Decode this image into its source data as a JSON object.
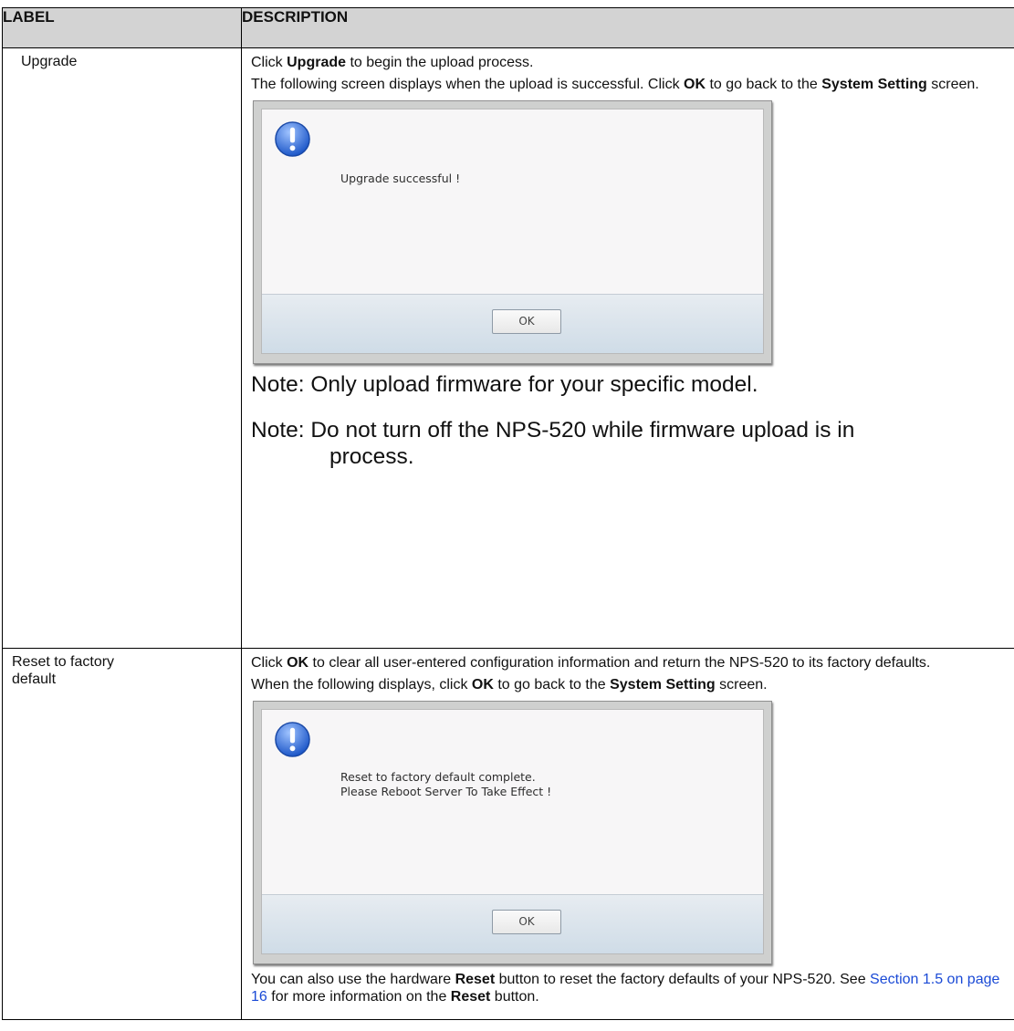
{
  "table": {
    "header_label": "LABEL",
    "header_description": "DESCRIPTION"
  },
  "rows": [
    {
      "label": "Upgrade",
      "p1": {
        "pre": "Click ",
        "b1": "Upgrade",
        "post": " to begin the upload process."
      },
      "p2": {
        "pre": "The following screen displays when the upload is successful. Click ",
        "b1": "OK",
        "mid": " to go back to the ",
        "b2": "System Setting",
        "post": " screen."
      },
      "dialog": {
        "message_line1": "Upgrade successful !",
        "ok_label": "OK"
      },
      "note1": "Note: Only upload firmware for your specific model.",
      "note2_line1": "Note: Do not turn off the NPS-520 while firmware upload is in",
      "note2_line2": "process."
    },
    {
      "label": "Reset to factory default",
      "p1": {
        "pre": "Click ",
        "b1": "OK",
        "post": " to clear all user-entered configuration information and return the NPS-520 to its factory defaults."
      },
      "p2": {
        "pre": "When the following displays, click ",
        "b1": "OK",
        "mid": " to go back to the ",
        "b2": "System Setting",
        "post": " screen."
      },
      "dialog": {
        "message_line1": "Reset to factory default complete.",
        "message_line2": "Please Reboot Server To Take Effect !",
        "ok_label": "OK"
      },
      "p3": {
        "pre": "You can also use the hardware ",
        "b1": "Reset",
        "mid": " button to reset the factory defaults of your NPS-520. See ",
        "link": "Section 1.5 on page 16",
        "mid2": " for more information on the ",
        "b2": "Reset",
        "post": " button."
      }
    }
  ],
  "colors": {
    "link": "#1a4ad6",
    "header_bg": "#d3d3d3",
    "icon_blue": "#2f6fd6"
  },
  "icons": {
    "dialog_icon": "exclamation-info-icon"
  }
}
